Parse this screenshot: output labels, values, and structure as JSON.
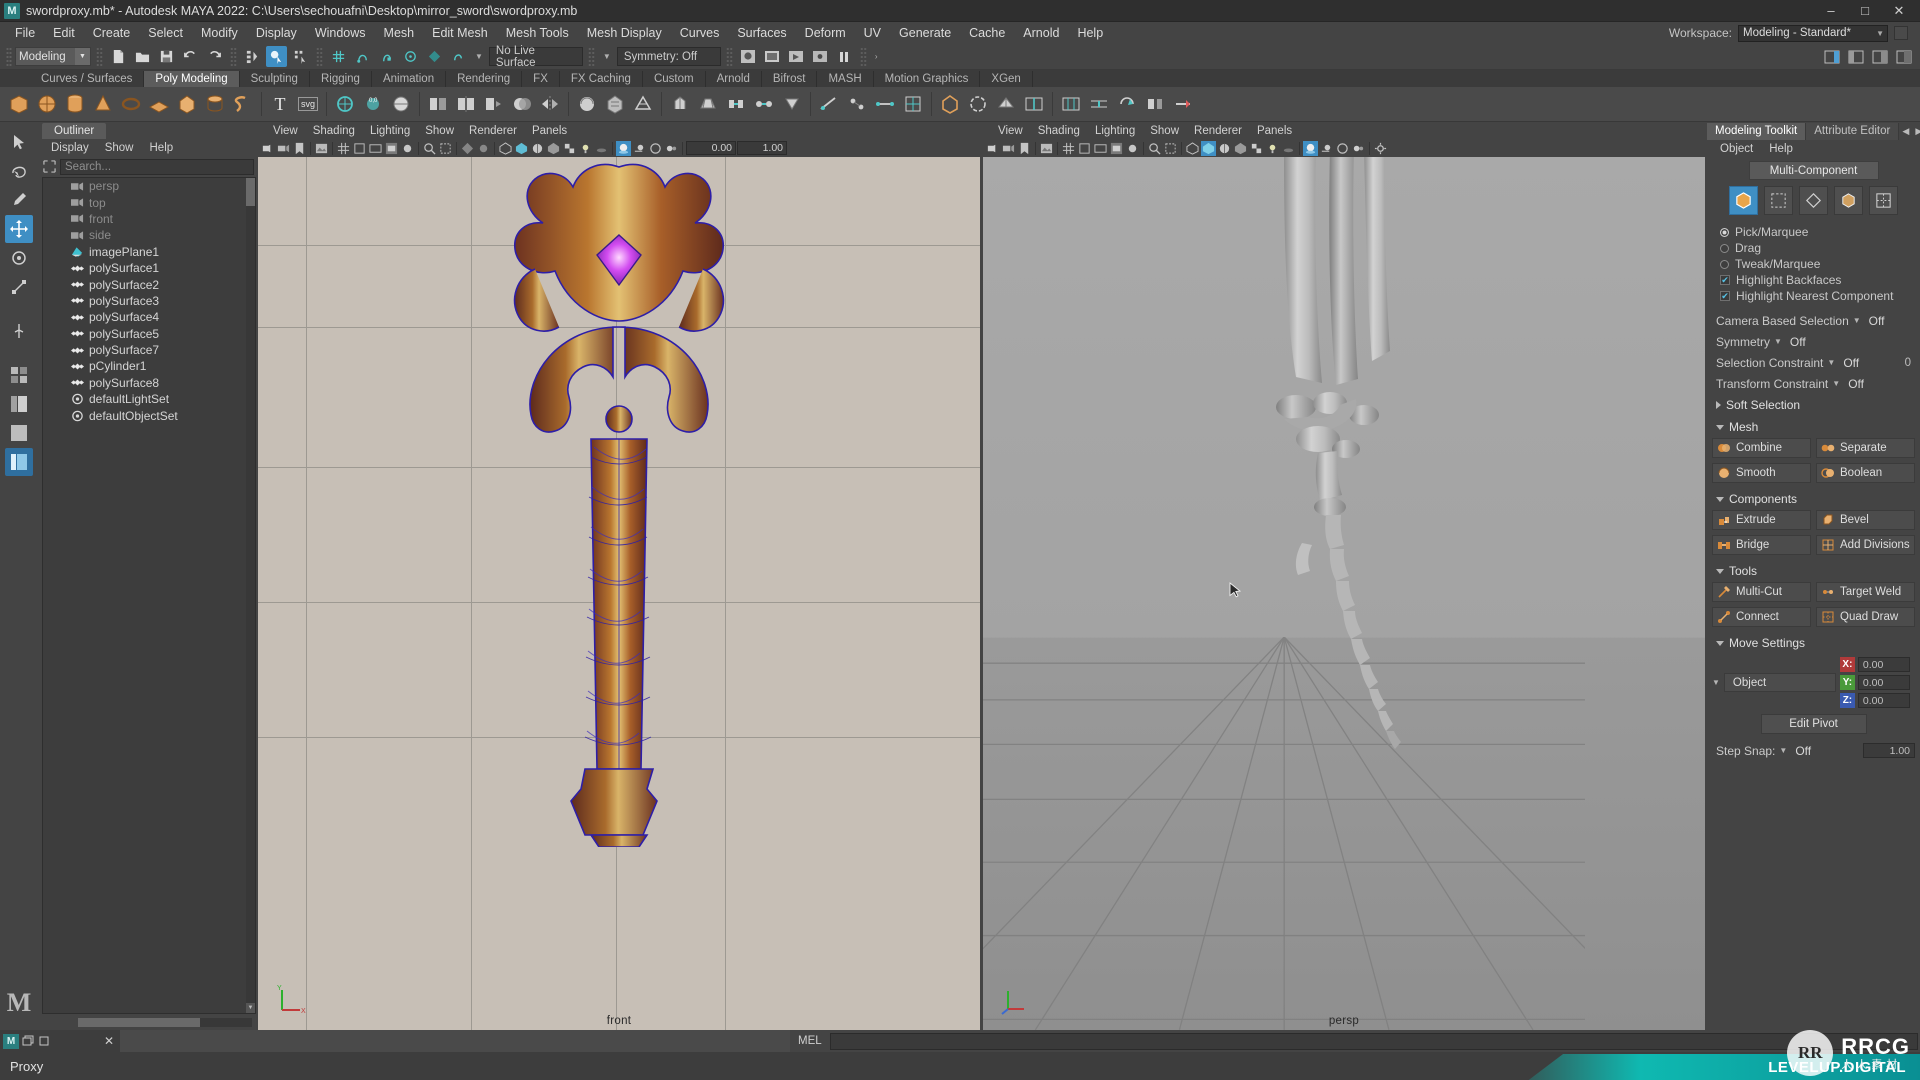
{
  "titlebar": {
    "logo": "M",
    "title": "swordproxy.mb* - Autodesk MAYA 2022: C:\\Users\\sechouafni\\Desktop\\mirror_sword\\swordproxy.mb",
    "minimize": "–",
    "maximize": "□",
    "close": "✕"
  },
  "menubar": {
    "items": [
      "File",
      "Edit",
      "Create",
      "Select",
      "Modify",
      "Display",
      "Windows",
      "Mesh",
      "Edit Mesh",
      "Mesh Tools",
      "Mesh Display",
      "Curves",
      "Surfaces",
      "Deform",
      "UV",
      "Generate",
      "Cache",
      "Arnold",
      "Help"
    ],
    "workspace_label": "Workspace:",
    "workspace_value": "Modeling - Standard*"
  },
  "statusline": {
    "mode": "Modeling",
    "live_surface": "No Live Surface",
    "symmetry": "Symmetry: Off",
    "icons": [
      "new-scene-icon",
      "open-scene-icon",
      "save-scene-icon",
      "undo-icon",
      "redo-icon",
      "select-by-hierarchy-icon",
      "select-by-object-icon",
      "select-by-component-icon",
      "snap-to-grid-icon",
      "snap-to-curve-icon",
      "snap-to-point-icon",
      "snap-to-projected-center-icon",
      "snap-to-view-plane-icon",
      "make-live-icon",
      "render-view-icon",
      "render-sequence-icon",
      "ipr-render-icon",
      "render-settings-icon",
      "pause-icon"
    ]
  },
  "shelftabs": {
    "items": [
      "Curves / Surfaces",
      "Poly Modeling",
      "Sculpting",
      "Rigging",
      "Animation",
      "Rendering",
      "FX",
      "FX Caching",
      "Custom",
      "Arnold",
      "Bifrost",
      "MASH",
      "Motion Graphics",
      "XGen"
    ],
    "active": "Poly Modeling"
  },
  "shelf": {
    "icons": [
      "poly-cube-icon",
      "poly-sphere-icon",
      "poly-cylinder-icon",
      "poly-cone-icon",
      "poly-torus-icon",
      "poly-plane-icon",
      "poly-prism-icon",
      "poly-pipe-icon",
      "poly-helix-icon",
      "type-tool-icon",
      "svg-tool-icon",
      "sculpt-target-icon",
      "soft-select-icon",
      "move-snap-icon",
      "combine-icon",
      "separate-icon",
      "extract-icon",
      "booleans-icon",
      "mirror-icon",
      "smooth-icon",
      "reduce-icon",
      "retopo-icon",
      "extrude-icon",
      "bevel-icon",
      "bridge-icon",
      "merge-icon",
      "collapse-icon",
      "multi-cut-icon",
      "target-weld-icon",
      "connect-icon",
      "quad-draw-icon",
      "crease-tool-icon",
      "fill-hole-icon",
      "append-polygon-icon",
      "insert-edge-loop-icon",
      "offset-edge-loop-icon",
      "slide-edge-icon",
      "spin-edge-icon",
      "detach-icon",
      "delete-edge-icon"
    ]
  },
  "toolbox": {
    "items": [
      "select-tool",
      "lasso-select-tool",
      "paint-select-tool",
      "move-tool",
      "rotate-tool",
      "scale-tool",
      "last-tool",
      "show-manipulator-tool",
      "outliner-layout",
      "four-view-layout",
      "persp-outliner-layout",
      "hypershade-layout"
    ],
    "logo": "M"
  },
  "outliner": {
    "tab": "Outliner",
    "menus": [
      "Display",
      "Show",
      "Help"
    ],
    "search_placeholder": "Search...",
    "items": [
      {
        "label": "persp",
        "icon": "camera-icon",
        "dim": true
      },
      {
        "label": "top",
        "icon": "camera-icon",
        "dim": true
      },
      {
        "label": "front",
        "icon": "camera-icon",
        "dim": true
      },
      {
        "label": "side",
        "icon": "camera-icon",
        "dim": true
      },
      {
        "label": "imagePlane1",
        "icon": "image-plane-icon",
        "dim": false
      },
      {
        "label": "polySurface1",
        "icon": "mesh-icon",
        "dim": false
      },
      {
        "label": "polySurface2",
        "icon": "mesh-icon",
        "dim": false
      },
      {
        "label": "polySurface3",
        "icon": "mesh-icon",
        "dim": false
      },
      {
        "label": "polySurface4",
        "icon": "mesh-icon",
        "dim": false
      },
      {
        "label": "polySurface5",
        "icon": "mesh-icon",
        "dim": false
      },
      {
        "label": "polySurface7",
        "icon": "mesh-icon",
        "dim": false
      },
      {
        "label": "pCylinder1",
        "icon": "mesh-icon",
        "dim": false
      },
      {
        "label": "polySurface8",
        "icon": "mesh-icon",
        "dim": false
      },
      {
        "label": "defaultLightSet",
        "icon": "set-icon",
        "dim": false
      },
      {
        "label": "defaultObjectSet",
        "icon": "set-icon",
        "dim": false
      }
    ]
  },
  "viewport_front": {
    "menus": [
      "View",
      "Shading",
      "Lighting",
      "Show",
      "Renderer",
      "Panels"
    ],
    "label": "front",
    "field1": "0.00",
    "field2": "1.00"
  },
  "viewport_persp": {
    "menus": [
      "View",
      "Shading",
      "Lighting",
      "Show",
      "Renderer",
      "Panels"
    ],
    "label": "persp"
  },
  "rightdock": {
    "tabs": [
      "Modeling Toolkit",
      "Attribute Editor"
    ],
    "active_tab": "Modeling Toolkit",
    "menus": [
      "Object",
      "Help"
    ],
    "multi_component": "Multi-Component",
    "component_modes": [
      "object-mode-icon",
      "vertex-mode-icon",
      "edge-mode-icon",
      "face-mode-icon",
      "uv-mode-icon"
    ],
    "selection_modes": [
      {
        "label": "Pick/Marquee",
        "on": true
      },
      {
        "label": "Drag",
        "on": false
      },
      {
        "label": "Tweak/Marquee",
        "on": false
      }
    ],
    "checkboxes": [
      {
        "label": "Highlight Backfaces",
        "on": true
      },
      {
        "label": "Highlight Nearest Component",
        "on": true
      }
    ],
    "options": [
      {
        "label": "Camera Based Selection",
        "value": "Off",
        "num": ""
      },
      {
        "label": "Symmetry",
        "value": "Off",
        "num": ""
      },
      {
        "label": "Selection Constraint",
        "value": "Off",
        "num": "0"
      },
      {
        "label": "Transform Constraint",
        "value": "Off",
        "num": ""
      }
    ],
    "soft_selection": "Soft Selection",
    "mesh_section": {
      "title": "Mesh",
      "buttons": [
        {
          "label": "Combine",
          "icon": "combine-icon"
        },
        {
          "label": "Separate",
          "icon": "separate-icon"
        },
        {
          "label": "Smooth",
          "icon": "smooth-icon"
        },
        {
          "label": "Boolean",
          "icon": "boolean-icon"
        }
      ]
    },
    "components_section": {
      "title": "Components",
      "buttons": [
        {
          "label": "Extrude",
          "icon": "extrude-icon"
        },
        {
          "label": "Bevel",
          "icon": "bevel-icon"
        },
        {
          "label": "Bridge",
          "icon": "bridge-icon"
        },
        {
          "label": "Add Divisions",
          "icon": "add-divisions-icon"
        }
      ]
    },
    "tools_section": {
      "title": "Tools",
      "buttons": [
        {
          "label": "Multi-Cut",
          "icon": "multi-cut-icon"
        },
        {
          "label": "Target Weld",
          "icon": "target-weld-icon"
        },
        {
          "label": "Connect",
          "icon": "connect-icon"
        },
        {
          "label": "Quad Draw",
          "icon": "quad-draw-icon"
        }
      ]
    },
    "move_settings": {
      "title": "Move Settings",
      "object": "Object",
      "x_label": "X:",
      "x_value": "0.00",
      "y_label": "Y:",
      "y_value": "0.00",
      "z_label": "Z:",
      "z_value": "0.00",
      "edit_pivot": "Edit Pivot",
      "step_snap_label": "Step Snap:",
      "step_snap_value": "Off",
      "step_snap_num": "1.00"
    }
  },
  "bottombar": {
    "win_logo": "M",
    "close": "✕",
    "mel_label": "MEL",
    "status": "Proxy"
  },
  "watermark": {
    "circle": "RR",
    "rrcg": "RRCG",
    "cn": "人人素材",
    "band": "LEVELUP.DIGITAL"
  },
  "colors": {
    "accent": "#3f8fc4",
    "panel": "#444444",
    "dark": "#3a3a3a",
    "teal": "#2a7f7f",
    "band": "#0fb9b1"
  }
}
